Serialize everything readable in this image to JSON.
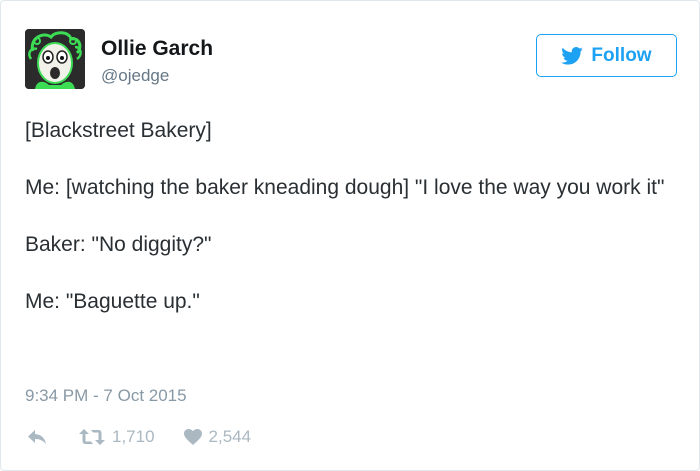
{
  "user": {
    "display_name": "Ollie Garch",
    "handle": "@ojedge",
    "avatar_icon": "green-ghost-face-avatar"
  },
  "follow": {
    "label": "Follow",
    "icon": "twitter-bird-icon",
    "color": "#1da1f2"
  },
  "tweet": {
    "lines": [
      "[Blackstreet Bakery]",
      "Me: [watching the baker kneading dough] \"I love the way you work it\"",
      "Baker: \"No diggity?\"",
      "Me: \"Baguette up.\""
    ],
    "timestamp": "9:34 PM - 7 Oct 2015"
  },
  "actions": {
    "reply_icon": "reply-icon",
    "retweet_icon": "retweet-icon",
    "retweet_count": "1,710",
    "like_icon": "heart-icon",
    "like_count": "2,544"
  },
  "colors": {
    "text": "#292f33",
    "muted": "#8899a6",
    "action": "#aab8c2",
    "avatar_green": "#39d353"
  }
}
